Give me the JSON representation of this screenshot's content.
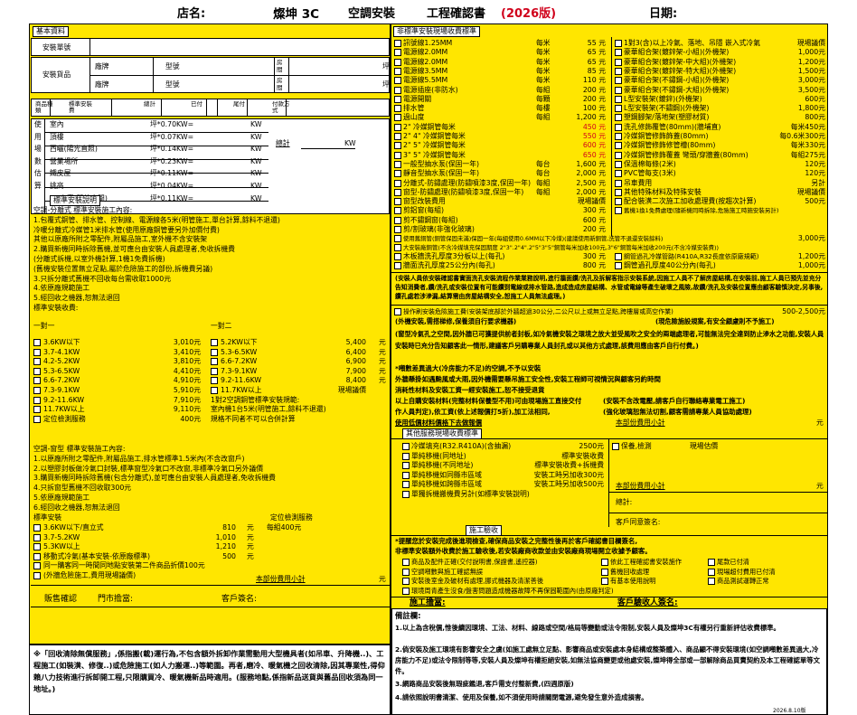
{
  "header": {
    "store": "店名:",
    "company": "燦坤 3C",
    "title": "空調安裝",
    "title2": "工程確認書",
    "year": "(2026版)",
    "date": "日期:"
  },
  "left": {
    "basic": "基本資料",
    "unit": "安裝單號",
    "goods": "安裝貨品",
    "brand": "廠牌",
    "model": "型號",
    "room": "房間",
    "ping": "坪",
    "th": [
      "商品種類",
      "標準安裝費",
      "總計",
      "已付",
      "尾付",
      "付款方式"
    ],
    "rooms": [
      {
        "k": "使",
        "n": "室內",
        "v": "坪*0.70KW="
      },
      {
        "k": "用",
        "n": "頂樓",
        "v": "坪*0.07KW="
      },
      {
        "k": "場",
        "n": "西曬(陽光直照)",
        "v": "坪*0.14KW="
      },
      {
        "k": "數",
        "n": "營業場所",
        "v": "坪*0.23KW="
      },
      {
        "k": "估",
        "n": "鐵皮屋",
        "v": "坪*0.11KW="
      },
      {
        "k": "算",
        "n": "挑高",
        "v": "坪*0.04KW="
      },
      {
        "k": "",
        "n": "客廳(開放空間)",
        "v": "坪*0.11KW="
      }
    ],
    "kw": "KW",
    "total": "總計",
    "desc_tag": "標準安裝說明",
    "desc": [
      "空調-分離式 標準安裝施工內容:",
      "1.包覆式銅管、排水管、控制線、電源線各5米(明管施工,單台計算,餘料不退還)",
      "冷暖分離式冷媒管1米排水管(使用原廠銅管要另外加價付費)",
      "其他以原廠所附之零配件,附屬品施工,室外機不含安裝架",
      "2.購買新機同時拆除舊機,並可應台由安裝人員處理者,免收拆機費",
      "(分離式拆機,以室外機計算,1機1免費拆機)",
      "(舊機安裝位置無立足點,屬於危險施工的部份,拆機費另議)",
      "3.只拆分離式舊機不回收每台需收取1000元",
      "4.依原廠規範施工",
      "5.經回收之機器,恕無法退回",
      "標準安裝收費:"
    ],
    "one": "一對一",
    "multi": "一對二",
    "p1": [
      {
        "n": "3.6KW以下",
        "p": "3,010元"
      },
      {
        "n": "3.7-4.1KW",
        "p": "3,410元"
      },
      {
        "n": "4.2-5.2KW",
        "p": "3,810元"
      },
      {
        "n": "5.3-6.5KW",
        "p": "4,410元"
      },
      {
        "n": "6.6-7.2KW",
        "p": "4,910元"
      },
      {
        "n": "7.3-9.1KW",
        "p": "5,910元"
      },
      {
        "n": "9.2-11.6KW",
        "p": "7,910元"
      },
      {
        "n": "11.7KW以上",
        "p": "9,110元"
      },
      {
        "n": "定位檢測服務",
        "p": "400元"
      }
    ],
    "p2": [
      {
        "n": "5.2KW以下",
        "p": "5,400",
        "u": "元"
      },
      {
        "n": "5.3-6.5KW",
        "p": "6,400",
        "u": "元"
      },
      {
        "n": "6.6-7.2KW",
        "p": "6,900",
        "u": "元"
      },
      {
        "n": "7.3-9.1KW",
        "p": "7,900",
        "u": "元"
      },
      {
        "n": "9.2-11.6KW",
        "p": "8,400",
        "u": "元"
      },
      {
        "n": "11.7KW以上",
        "p": "現場議價",
        "u": ""
      },
      {
        "n": "1對2空調銅管標準安裝規範:",
        "p": "",
        "u": ""
      },
      {
        "n": "室內機1台5米(明管施工,餘料不退還)",
        "p": "",
        "u": ""
      },
      {
        "n": "規格不同者不可以合併計算",
        "p": "",
        "u": ""
      }
    ],
    "win": [
      "空調-窗型 標準安裝施工內容:",
      "1.以原廠所附之零配件,附屬品施工,排水管標準1.5米內(不含改窗戶)",
      "2.以塑膠封板做冷氣口封裝,標準窗型冷氣口不改窗,非標準冷氣口另外議價",
      "3.購買新機同時拆除舊機(包含分離式),並可應台由安裝人員處理者,免收拆機費",
      "4.只拆窗型舊機不回收取300元",
      "5.依原廠規範施工",
      "6.經回收之機器,恕無法退回"
    ],
    "win_std": "標準安裝",
    "win_pos": "定位檢測服務",
    "win_price": "每組400元",
    "w": [
      {
        "n": "3.6KW以下/直立式",
        "p": "810",
        "u": "元"
      },
      {
        "n": "3.7-5.2KW",
        "p": "1,010",
        "u": "元"
      },
      {
        "n": "5.3KW以上",
        "p": "1,210",
        "u": "元"
      },
      {
        "n": "移動式冷氣(基本安裝-依原廠標準)",
        "p": "500",
        "u": "元"
      },
      {
        "n": "同一購客同一時間同地點安裝第二件商品折價100元",
        "p": "",
        "u": ""
      },
      {
        "n": "(外牆危險施工,費用現場議價)",
        "p": "",
        "u": ""
      }
    ],
    "local_fee": "本部份費用小計",
    "yuan": "元",
    "sign_sale": "販售確認",
    "sign_store": "門市擔當:",
    "sign_cust": "客戶簽名:"
  },
  "note": "※「回收清除無償服務」,係指搬(載)運行為,不包含額外拆卸作業需動用大型機具者(如吊車、升降機..)、工程施工(如裝潢、修復..)或危險施工(如人力搬運..)等範圍。再者,磨冷、暖氣機之回收清除,因其專業性,得仰賴八力技術進行拆卸開工程,只限購買冷、暖氣機新品時適用。(服務地點,係指新品送貨與舊品回收須為同一地址。)",
  "right": {
    "tag": "非標準安裝現場收費標準",
    "a": [
      {
        "n": "訊號線1.25MM",
        "u": "每米",
        "p": "55 元",
        "r": 0
      },
      {
        "n": "電源線2.0MM",
        "u": "每米",
        "p": "65 元",
        "r": 0
      },
      {
        "n": "電源線2.0MM",
        "u": "每米",
        "p": "65 元",
        "r": 0
      },
      {
        "n": "電源線3.5MM",
        "u": "每米",
        "p": "85 元",
        "r": 0
      },
      {
        "n": "電源線5.5MM",
        "u": "每米",
        "p": "110 元",
        "r": 0
      },
      {
        "n": "電源插座(非防水)",
        "u": "每組",
        "p": "200 元",
        "r": 0
      },
      {
        "n": "電源開關",
        "u": "每顆",
        "p": "200 元",
        "r": 0
      },
      {
        "n": "排水管",
        "u": "每樓",
        "p": "100 元",
        "r": 0
      },
      {
        "n": "過山度",
        "u": "每組",
        "p": "1,200 元",
        "r": 0
      },
      {
        "n": "2\" 冷媒銅管每米",
        "u": "",
        "p": "450 元",
        "r": 1
      },
      {
        "n": "2\" 4\" 冷媒銅管每米",
        "u": "",
        "p": "550 元",
        "r": 1
      },
      {
        "n": "2\" 5\" 冷媒銅管每米",
        "u": "",
        "p": "600 元",
        "r": 1
      },
      {
        "n": "3\" 5\" 冷媒銅管每米",
        "u": "",
        "p": "650 元",
        "r": 1
      },
      {
        "n": "一般型抽水泵(保固一年)",
        "u": "每台",
        "p": "1,600 元",
        "r": 0
      },
      {
        "n": "靜音型抽水泵(保固一年)",
        "u": "每台",
        "p": "2,000 元",
        "r": 0
      },
      {
        "n": "分離式-防鏽處理(防鏽噴漆3度,保固一年)",
        "u": "每組",
        "p": "2,500 元",
        "r": 0
      },
      {
        "n": "窗型-防鏽處理(防鏽噴漆3度,保固一年)",
        "u": "每組",
        "p": "2,000 元",
        "r": 0
      },
      {
        "n": "窗型改裝費用",
        "u": "",
        "p": "現場議價",
        "r": 0
      },
      {
        "n": "剪鋁窗(每組)",
        "u": "",
        "p": "300 元",
        "r": 0
      },
      {
        "n": "剪不鏽鋼窗(每組)",
        "u": "",
        "p": "600 元",
        "r": 0
      },
      {
        "n": "剪/割玻璃(非強化玻璃)",
        "u": "",
        "p": "200 元",
        "r": 0
      }
    ],
    "b": [
      {
        "n": "1對3(含)以上冷氣、落地、吊隱 嵌入式冷氣",
        "p": "現場議價"
      },
      {
        "n": "豪華組合架(鍍鋅架-小組)(外機架)",
        "p": "1,000元"
      },
      {
        "n": "豪華組合架(鍍鋅架-中大組)(外機架)",
        "p": "1,200元"
      },
      {
        "n": "豪華組合架(鍍鋅架-特大組)(外機架)",
        "p": "1,500元"
      },
      {
        "n": "豪華組合架(不鏽鋼-小組)(外機架)",
        "p": "3,000元"
      },
      {
        "n": "豪華組合架(不鏽鋼-大組)(外機架)",
        "p": "3,500元"
      },
      {
        "n": "L型安裝架(鍍鋅)(外機架)",
        "p": "600元"
      },
      {
        "n": "L型安裝架(不鏽鋼)(外機架)",
        "p": "1,800元"
      },
      {
        "n": "塑鋼腳架/落地架(塑膠材質)",
        "p": "800元"
      },
      {
        "n": "洗孔修飾覆管(80mm)(牆埔直)",
        "p": "每米450元"
      },
      {
        "n": "冷媒銅管修飾飾蓋(80mm)",
        "p": "每0.6米300元"
      },
      {
        "n": "冷媒銅管修飾修管槽(80mm)",
        "p": "每米330元"
      },
      {
        "n": "冷媒銅管修飾覆蓋 彎頭/穿牆蓋(80mm)",
        "p": "每組275元"
      },
      {
        "n": "保溫棉每條(2米)",
        "p": "120元"
      },
      {
        "n": "PVC管每支(3米)",
        "p": "120元"
      },
      {
        "n": "吊車費用",
        "p": "另計"
      },
      {
        "n": "其他特殊材料及特殊安裝",
        "p": "現場議價"
      },
      {
        "n": "配合裝潢二次施工加收處理費(按趨次計算)",
        "p": "500元"
      },
      {
        "n": "舊機1換1免費處理(隨新機同時拆除,危險施工時施安裝另計)",
        "p": ""
      }
    ],
    "c1": "使用舊銅管(銅管保固未滿)保固一年(每組使用0.6MM以下冷煤)(建議使用新銅管,洗管不退還安裝餘料)",
    "c1p": "3,000元",
    "c2": "大安裝廠銅管(不含冷媒填充保固期度 2\"3\".2\"4\".2\"5\"3\"5\"銅管每米加收100元,3\"6\"銅管每米加收200元(不含冷媒安裝費))",
    "c3": "木板牆洗孔厚度3分板以上(每孔)",
    "c3p": "300 元",
    "c3b": "鋼管過孔冷媒管路(R410A,R32長度依原廠規範)",
    "c3bp": "1,200元",
    "c4": "牆面洗孔厚度25公分內(每孔)",
    "c4p": "800 元",
    "c4b": "鋼管過孔厚度40公分內(每孔)",
    "c4bp": "1,000元",
    "warn1": "(安裝人員依安裝確認書實面洗孔安裝流程作業業務說明,進行牆面鑽/洗孔及拆解客指示安裝系統,因施工人員不了解房屋結構,在安裝前,施工人員已預先並充分告知消費者,鑽/洗孔或安裝位置有可能鑽到電線或排水管路,造成造成房屋結構、水管或電線等產生破壞之風險,故鑽/洗孔及安裝位置應由顧客驗慎決定,另事後,鑽孔處若涉滲漏,結算需由房屋結構安全,恕施工人員無法處理。)",
    "warn2": "操作刷安裝危險施工費(安裝架底部於外牆超過30公分,二公尺以上或無立足點,跨樓層或高空作業)",
    "warn2p": "500-2,500元",
    "warn3": "(外機安裝,需搭梯修,保養須自行要求機器)",
    "warn3b": "(現危險施設規案,有安全顧慮則不予施工)",
    "warn4": "(窗型冷氣孔之空間,因外牆已可獲提供前者封板,如冷氣機安裝之環境之放大並受風吹之安全的兩端處理者,可能無法完全達到防止滲水之功能,安裝人員安裝時已充分告知顧客此一情形,建議客戶另購專業人員封孔或以其他方式處理,該費用應由客戶自行付費。)",
    "warn5": "*噸數差異過大(冷房能力不足)的空調,不予以安裝",
    "warn6": "外牆懸掛如遇颱風或大雨,因外機需要懸吊施工安全性,安裝工程師可視情況與顧客另約時間",
    "warn7": "消耗性材料及安裝工資一經安裝施工,恕不接受退貨",
    "warn8": "以上自購安裝材料(完整材料保養型不用)可由現場施工直接交付",
    "warn8b": "(安裝不含改電壓,請客戶自行聯絡專業電工施工)",
    "warn9": "作人員判定),依工資(依上述報價打5折),加工法相同,",
    "warn9b": "(強化玻璃恕無法切割,顧客需請專業人員協助處理)",
    "warn10": "使用低價材料價格下去做報價",
    "local_fee": "本部份費用小計",
    "yuan": "元",
    "other_tag": "其他服務現場收費標準",
    "o": [
      {
        "n": "冷媒填充(R32.R410A)(含抽漏)",
        "p": "2500元"
      },
      {
        "n": "單純移機(同地址)",
        "p": "標準安裝收費"
      },
      {
        "n": "單純移機(不同地址)",
        "p": "標準安裝收費+拆機費"
      },
      {
        "n": "單純移機如同縣市區域",
        "p": "安裝工時另加收300元"
      },
      {
        "n": "單純移機如跨縣市區域",
        "p": "安裝工時另加收500元"
      },
      {
        "n": "單獨拆機搬機費另計(如標準安裝說明)",
        "p": ""
      }
    ],
    "o_check": "保養,檢測",
    "o_check_p": "現場估價",
    "o_fee": "本部份費用小計",
    "o_sum": "總計:",
    "o_cust": "客戶同意簽名:",
    "construct_tag": "施工驗收",
    "acc1": "*提醒您於安裝完成後進現檢查,確保商品安裝之完整性後再於客戶確認書目欄簽名,",
    "acc2": "非標準安裝額外收費於施工驗收後,若安裝廠商收款並由安裝廠商現場開立收據予顧客。",
    "acc": [
      "商品及配件正確(交付說明書,保證書,遙控器)",
      "依此工程確認書安裝施作",
      "尾款已付清",
      "空調噸數與施工確認無誤",
      "舊機回收處理",
      "現場超付費用已付清",
      "安裝後室金及破材有處理,挪式機器及清潔善後",
      "有基本使用說明",
      "商品測試運轉正常",
      "環境周青產生沒食/盤害問題造成機器故障不再保固範圍內(由原廠判定)"
    ],
    "sign_builder": "施工擔當:",
    "sign_cust": "客戶驗收人簽名:",
    "memo_h": "備註欄:",
    "memo": [
      "1.以上為含稅價,惟後續因環境、工法、材料、線路或空間/格局等變動或法令限制,安裝人員及燦坤3C有權另行重新評估收費標準。",
      "2.倘安裝及施工環境有影響安全之虞(如施工處無立足點、影響商品或安裝處本身結構或整築體入、商品顯不得安裝環境(如空調噸數差異過大,冷房能力不足)或法令限制等等,安裝人員及燦坤有權拒絕安裝,如無法協商變更或他處安裝,燦坤得全部或一部解除商品買賣契約及本工程確認單等文件。",
      "3.網路商品安裝後無瑕疵鑑退,客戶需支付整新費,(四週原版)",
      "4.請依照說明書清潔、使用及保養,如不須使用時請關閉電源,避免發生意外造成損害。"
    ],
    "version": "2026.8.10版"
  }
}
